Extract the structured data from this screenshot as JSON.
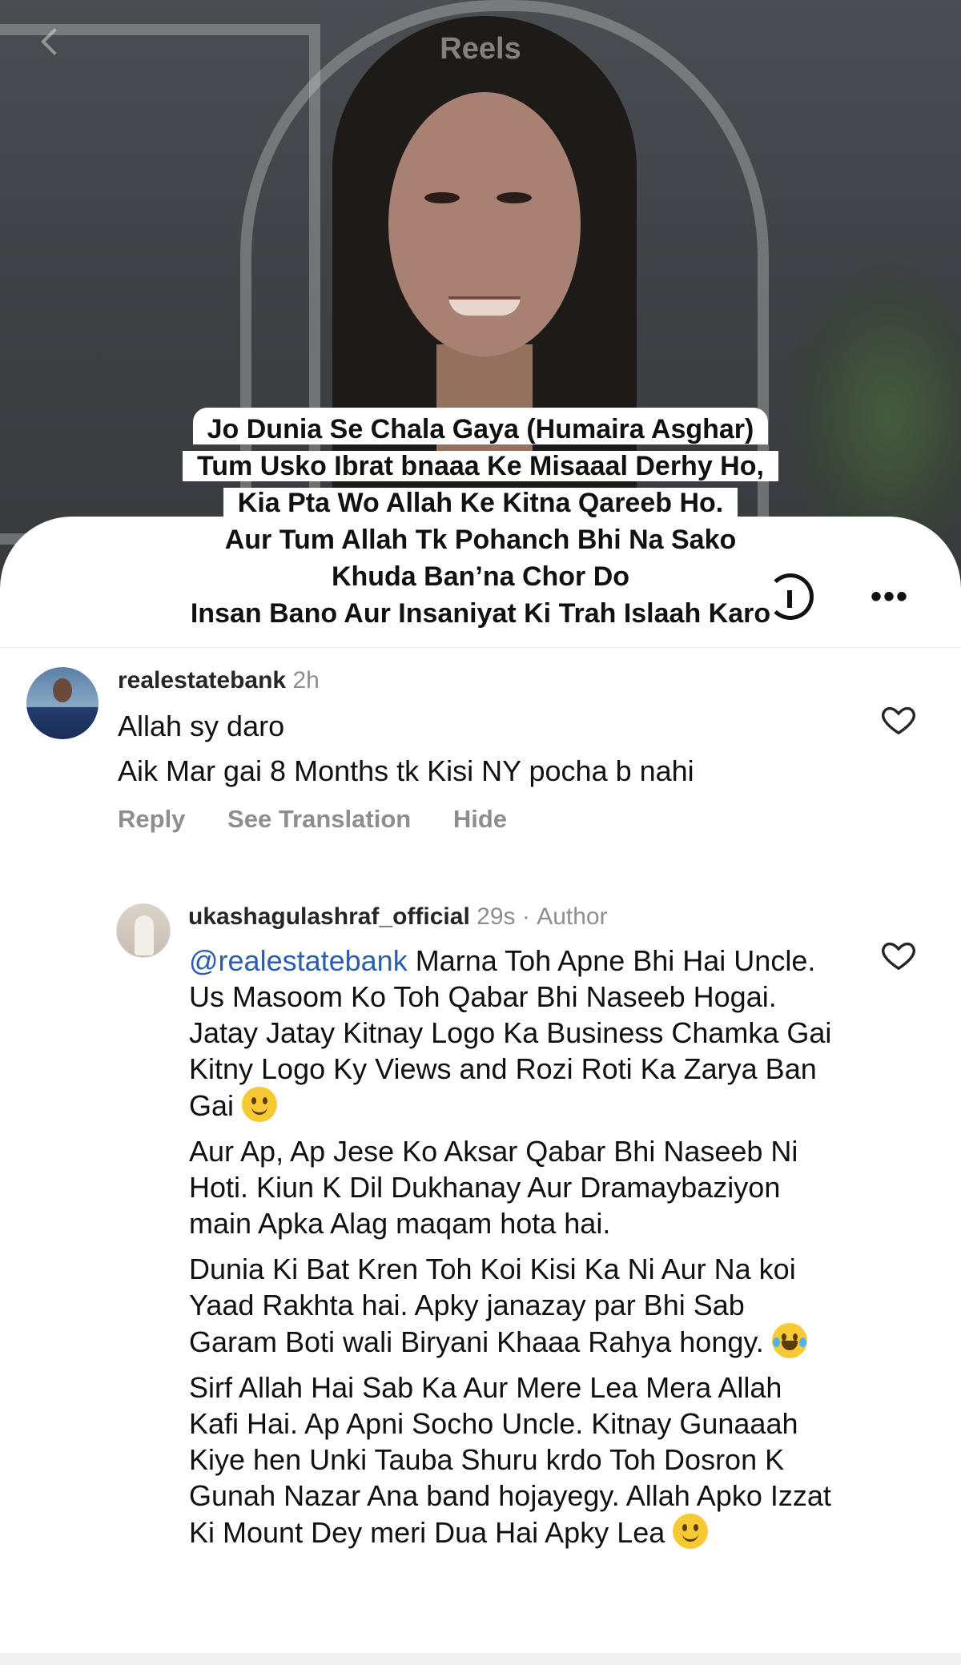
{
  "header": {
    "title": "Reels"
  },
  "caption": {
    "lines": [
      "Jo Dunia Se Chala Gaya (Humaira Asghar)",
      "Tum Usko Ibrat bnaaa Ke Misaaal Derhy Ho,",
      "Kia Pta Wo Allah Ke Kitna Qareeb Ho.",
      "Aur Tum Allah Tk Pohanch Bhi Na Sako",
      "Khuda Ban’na Chor Do",
      "Insan Bano Aur Insaniyat Ki Trah Islaah Karo"
    ]
  },
  "icons": {
    "reel_icon": "reel-remix-icon",
    "more": "more-options-icon",
    "back": "back-chevron-icon"
  },
  "comments": [
    {
      "username": "realestatebank",
      "time": "2h",
      "lines": [
        "Allah sy daro",
        "Aik Mar gai 8 Months tk Kisi NY pocha b nahi"
      ],
      "actions": {
        "reply": "Reply",
        "translate": "See Translation",
        "hide": "Hide"
      }
    }
  ],
  "reply": {
    "username": "ukashagulashraf_official",
    "time": "29s",
    "separator": "·",
    "badge": "Author",
    "mention": "@realestatebank",
    "paragraphs": [
      " Marna Toh Apne Bhi Hai Uncle. Us Masoom Ko Toh Qabar Bhi Naseeb Hogai. Jatay Jatay Kitnay Logo Ka Business Chamka Gai Kitny Logo Ky Views and Rozi Roti Ka Zarya Ban Gai",
      "Aur Ap, Ap Jese Ko Aksar Qabar Bhi Naseeb Ni Hoti. Kiun K Dil Dukhanay Aur Dramaybaziyon main Apka Alag maqam hota hai.",
      "Dunia Ki Bat Kren Toh Koi Kisi Ka Ni Aur Na koi Yaad Rakhta hai. Apky janazay par Bhi Sab Garam Boti wali Biryani Khaaa Rahya hongy.",
      "Sirf Allah Hai Sab Ka Aur Mere Lea Mera Allah Kafi Hai. Ap Apni Socho Uncle. Kitnay Gunaaah Kiye hen Unki Tauba Shuru krdo Toh Dosron K Gunah Nazar Ana band hojayegy. Allah Apko Izzat Ki Mount Dey meri Dua Hai Apky Lea"
    ]
  }
}
